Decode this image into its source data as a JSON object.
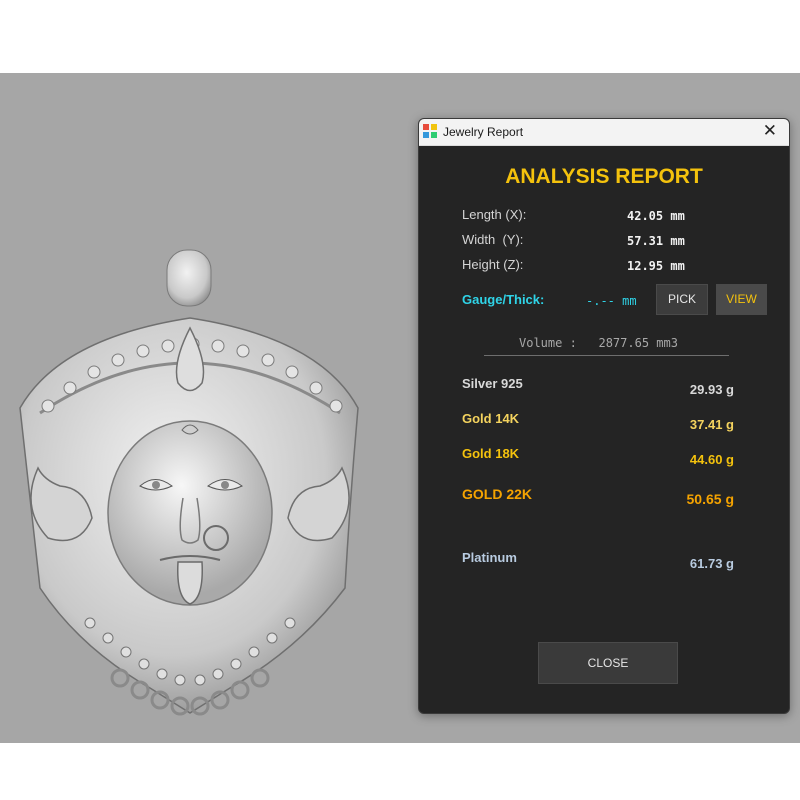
{
  "window": {
    "title": "Jewelry Report",
    "close_glyph": "✕"
  },
  "report": {
    "heading": "ANALYSIS REPORT",
    "dimensions": [
      {
        "label": "Length (X):",
        "value": "42.05 mm"
      },
      {
        "label": "Width  (Y):",
        "value": "57.31 mm"
      },
      {
        "label": "Height (Z):",
        "value": "12.95 mm"
      }
    ],
    "gauge": {
      "label": "Gauge/Thick:",
      "value": "-.-- mm"
    },
    "pick_label": "PICK",
    "view_label": "VIEW",
    "volume": {
      "label": "Volume :",
      "value": "2877.65 mm3"
    },
    "metals": [
      {
        "label": "Silver 925",
        "value": "29.93 g",
        "color": "#d9d9d9"
      },
      {
        "label": "Gold 14K",
        "value": "37.41 g",
        "color": "#f4d35e"
      },
      {
        "label": "Gold 18K",
        "value": "44.60 g",
        "color": "#f4c20d"
      },
      {
        "label": "GOLD 22K",
        "value": "50.65 g",
        "color": "#f5a300"
      },
      {
        "label": "Platinum",
        "value": "61.73 g",
        "color": "#b8cbe0"
      }
    ],
    "close_label": "CLOSE"
  },
  "colors": {
    "viewport_bg": "#a6a6a6",
    "panel_bg": "#242424",
    "accent_gold": "#f4c20d",
    "accent_cyan": "#2fd4e8"
  },
  "icons": [
    "app-icon",
    "close-icon",
    "pendant-model"
  ]
}
